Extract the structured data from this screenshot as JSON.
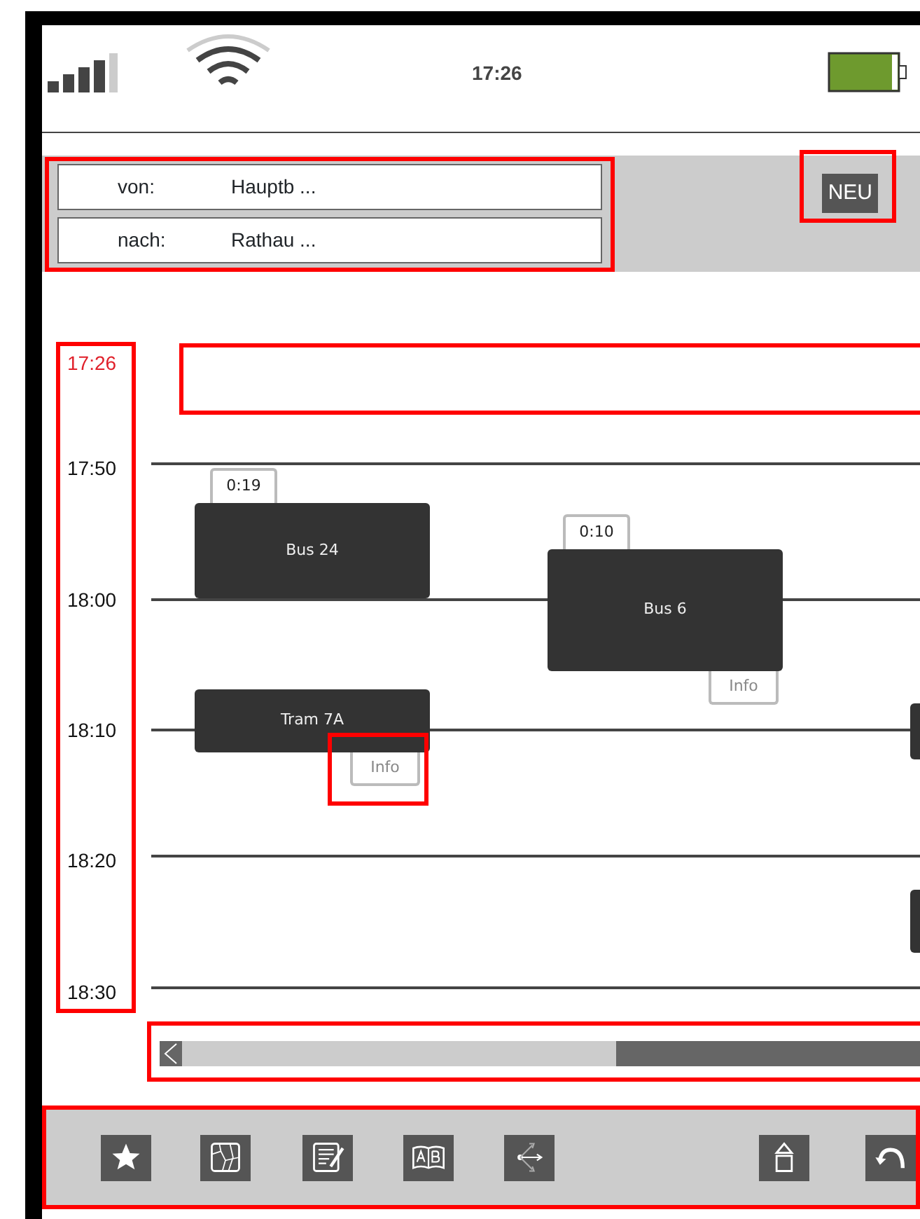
{
  "status_bar": {
    "time": "17:26"
  },
  "route": {
    "highlighted": true,
    "fields": [
      {
        "label": "von:",
        "value": "Hauptb ..."
      },
      {
        "label": "nach:",
        "value": "Rathau ..."
      }
    ]
  },
  "new_button": {
    "label": "NEU",
    "highlighted": true
  },
  "timeline": {
    "times_highlighted": true,
    "current_row_highlighted": true,
    "times": [
      {
        "time": "17:26",
        "current": true
      },
      {
        "time": "17:50",
        "current": false
      },
      {
        "time": "18:00",
        "current": false
      },
      {
        "time": "18:10",
        "current": false
      },
      {
        "time": "18:20",
        "current": false
      },
      {
        "time": "18:30",
        "current": false
      }
    ],
    "trips": [
      {
        "name": "Bus 24",
        "duration": "0:19",
        "clipped": false
      },
      {
        "name": "Bus 6",
        "duration": "0:10",
        "info": "Info",
        "clipped": false
      },
      {
        "name": "Tram 7A",
        "info": "Info",
        "info_highlighted": true,
        "clipped": false
      },
      {
        "clipped": true
      },
      {
        "clipped": true
      }
    ]
  },
  "scrollbar": {
    "highlighted": true
  },
  "toolbar": {
    "highlighted": true,
    "buttons": [
      {
        "kind": "star"
      },
      {
        "kind": "map"
      },
      {
        "kind": "notes"
      },
      {
        "kind": "book"
      },
      {
        "kind": "share"
      },
      {
        "kind": "home"
      },
      {
        "kind": "back"
      }
    ]
  }
}
